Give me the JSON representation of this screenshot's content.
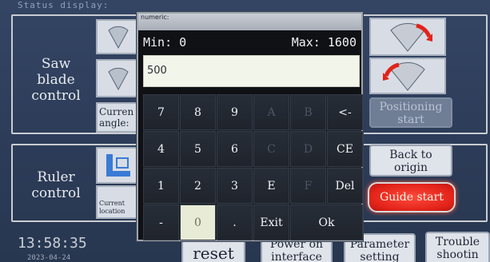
{
  "status_display_text": "Status display:",
  "saw_panel": {
    "label": "Saw\nblade\ncontrol",
    "current_angle_label": "Curren\nangle:",
    "positioning_start_label": "Positioning\nstart"
  },
  "ruler_panel": {
    "label": "Ruler\ncontrol",
    "current_location_label": "Current\nlocation"
  },
  "buttons": {
    "back_to_origin": "Back to\norigin",
    "guide_start": "Guide start",
    "reset": "reset",
    "power_on_interface": "Power on\ninterface",
    "parameter_setting": "Parameter\nsetting",
    "troubleshooting": "Trouble\nshootin"
  },
  "clock": {
    "time": "13:58:35",
    "date": "2023-04-24"
  },
  "numeric_popup": {
    "title": "numeric:",
    "min_label": "Min: 0",
    "max_label": "Max: 1600",
    "value": "500",
    "keys": [
      [
        "7",
        "8",
        "9",
        "A",
        "B",
        "<-"
      ],
      [
        "4",
        "5",
        "6",
        "C",
        "D",
        "CE"
      ],
      [
        "1",
        "2",
        "3",
        "E",
        "F",
        "Del"
      ],
      [
        "-",
        "0",
        ".",
        "Exit",
        "Ok"
      ]
    ]
  },
  "colors": {
    "background": "#2f3f58",
    "accent_red": "#e2231a",
    "popup_dark": "#0f1114",
    "entry_bg": "#f2f5ea"
  }
}
